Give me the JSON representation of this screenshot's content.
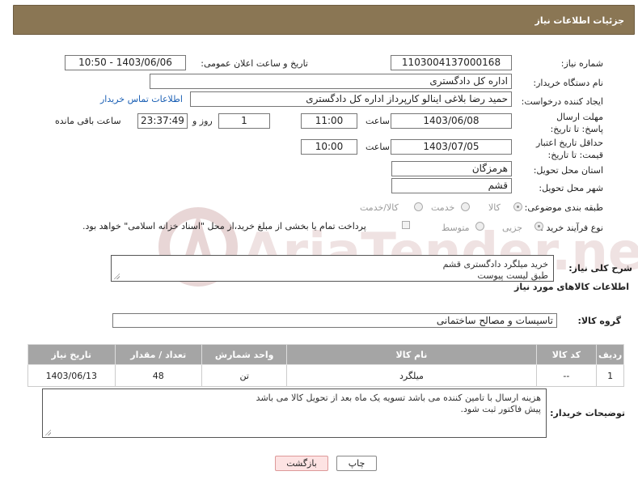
{
  "header": {
    "title": "جزئیات اطلاعات نیاز"
  },
  "need_number": {
    "label": "شماره نیاز:",
    "value": "1103004137000168"
  },
  "announce_datetime": {
    "label": "تاریخ و ساعت اعلان عمومی:",
    "value": "1403/06/06 - 10:50"
  },
  "buyer_org": {
    "label": "نام دستگاه خریدار:",
    "value": "اداره کل دادگستری"
  },
  "creator": {
    "label": "ایجاد کننده درخواست:",
    "value": "حمید رضا  بلاغی اینالو کارپرداز اداره کل دادگستری",
    "contact_link": "اطلاعات تماس خریدار"
  },
  "reply_deadline": {
    "label": "مهلت ارسال پاسخ: تا تاریخ:",
    "date": "1403/06/08",
    "time_label": "ساعت",
    "time": "11:00",
    "days": "1",
    "days_label": "روز و",
    "remaining": "23:37:49",
    "remaining_label": "ساعت باقی مانده"
  },
  "price_validity": {
    "label": "حداقل تاریخ اعتبار قیمت: تا تاریخ:",
    "date": "1403/07/05",
    "time_label": "ساعت",
    "time": "10:00"
  },
  "province": {
    "label": "استان محل تحویل:",
    "value": "هرمزگان"
  },
  "city": {
    "label": "شهر محل تحویل:",
    "value": "قشم"
  },
  "category": {
    "label": "طبقه بندی موضوعی:",
    "options": [
      "کالا",
      "خدمت",
      "کالا/خدمت"
    ]
  },
  "process": {
    "label": "نوع فرآیند خرید :",
    "options": [
      "جزیی",
      "متوسط"
    ],
    "note": "پرداخت تمام یا بخشی از مبلغ خرید،از محل \"اسناد خزانه اسلامی\" خواهد بود."
  },
  "description": {
    "label": "شرح کلی نیاز:",
    "line1": "خرید میلگرد دادگستری قشم",
    "line2": "طبق لیست پیوست"
  },
  "goods_section_title": "اطلاعات کالاهای مورد نیاز",
  "goods_group": {
    "label": "گروه کالا:",
    "value": "تاسیسات و مصالح ساختمانی"
  },
  "table": {
    "headers": [
      "ردیف",
      "کد کالا",
      "نام کالا",
      "واحد شمارش",
      "تعداد / مقدار",
      "تاریخ نیاز"
    ],
    "rows": [
      [
        "1",
        "--",
        "میلگرد",
        "تن",
        "48",
        "1403/06/13"
      ]
    ]
  },
  "buyer_notes": {
    "label": "توضیحات خریدار:",
    "line1": "هزینه ارسال با تامین کننده می باشد تسویه یک ماه بعد از تحویل کالا می باشد",
    "line2": "پیش فاکتور ثبت شود."
  },
  "buttons": {
    "print": "چاپ",
    "back": "بازگشت"
  },
  "watermark": {
    "text": "AriaTender.neT"
  },
  "colors": {
    "header_bg": "#8a7654",
    "table_header": "#a5a5a5",
    "link": "#1a5fb4",
    "back_btn_bg": "#fde3e3"
  }
}
